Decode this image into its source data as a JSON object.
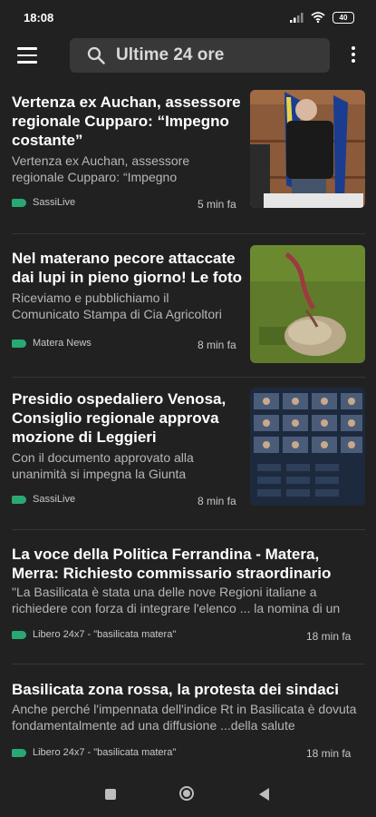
{
  "status": {
    "time": "18:08",
    "battery": "40"
  },
  "search": {
    "query": "Ultime 24 ore"
  },
  "articles": [
    {
      "title": "Vertenza ex Auchan, assessore regionale Cupparo: “Impegno costante”",
      "snippet": "Vertenza ex Auchan, assessore regionale Cupparo: “Impegno",
      "source": "SassiLive",
      "time": "5 min fa"
    },
    {
      "title": "Nel materano pecore attaccate dai lupi in pieno giorno! Le foto",
      "snippet": "Riceviamo e pubblichiamo il Comunicato Stampa di Cia Agricoltori",
      "source": "Matera News",
      "time": "8 min fa"
    },
    {
      "title": "Presidio ospedaliero Venosa, Consiglio regionale approva mozione di Leggieri",
      "snippet": "Con il documento approvato alla unanimità si impegna la Giunta",
      "source": "SassiLive",
      "time": "8 min fa"
    },
    {
      "title": "La voce della Politica Ferrandina - Matera, Merra: Richiesto commissario straordinario",
      "snippet": "\"La Basilicata è stata una delle nove Regioni italiane a richiedere con forza di integrare l'elenco ... la nomina di un",
      "source": "Libero 24x7 - \"basilicata matera\"",
      "time": "18 min fa"
    },
    {
      "title": "Basilicata zona rossa, la protesta dei sindaci",
      "snippet": "Anche perché l'impennata dell'indice Rt in Basilicata è dovuta fondamentalmente ad una diffusione ...della salute",
      "source": "Libero 24x7 - \"basilicata matera\"",
      "time": "18 min fa"
    }
  ],
  "colors": {
    "background": "#212121",
    "search_bg": "#383838",
    "source_tag": "#2aa874"
  }
}
